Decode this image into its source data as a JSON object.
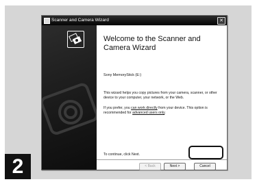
{
  "step_number": "2",
  "window": {
    "title": "Scanner and Camera Wizard",
    "close_glyph": "✕"
  },
  "wizard": {
    "heading": "Welcome to the Scanner and Camera Wizard",
    "device_name": "Sony MemoryStick (E:)",
    "description": "This wizard helps you copy pictures from your camera, scanner, or other device to your computer, your network, or the Web.",
    "option_prefix": "If you prefer, you ",
    "option_link": "can work directly",
    "option_middle": " from your device. This option is recommended for ",
    "option_link2": "advanced users only",
    "option_suffix": ".",
    "continue_text": "To continue, click Next."
  },
  "buttons": {
    "back": "< Back",
    "next": "Next >",
    "cancel": "Cancel"
  },
  "icons": {
    "title": "scanner-camera-icon",
    "wizard": "camera-photos-icon",
    "close": "close-icon"
  }
}
